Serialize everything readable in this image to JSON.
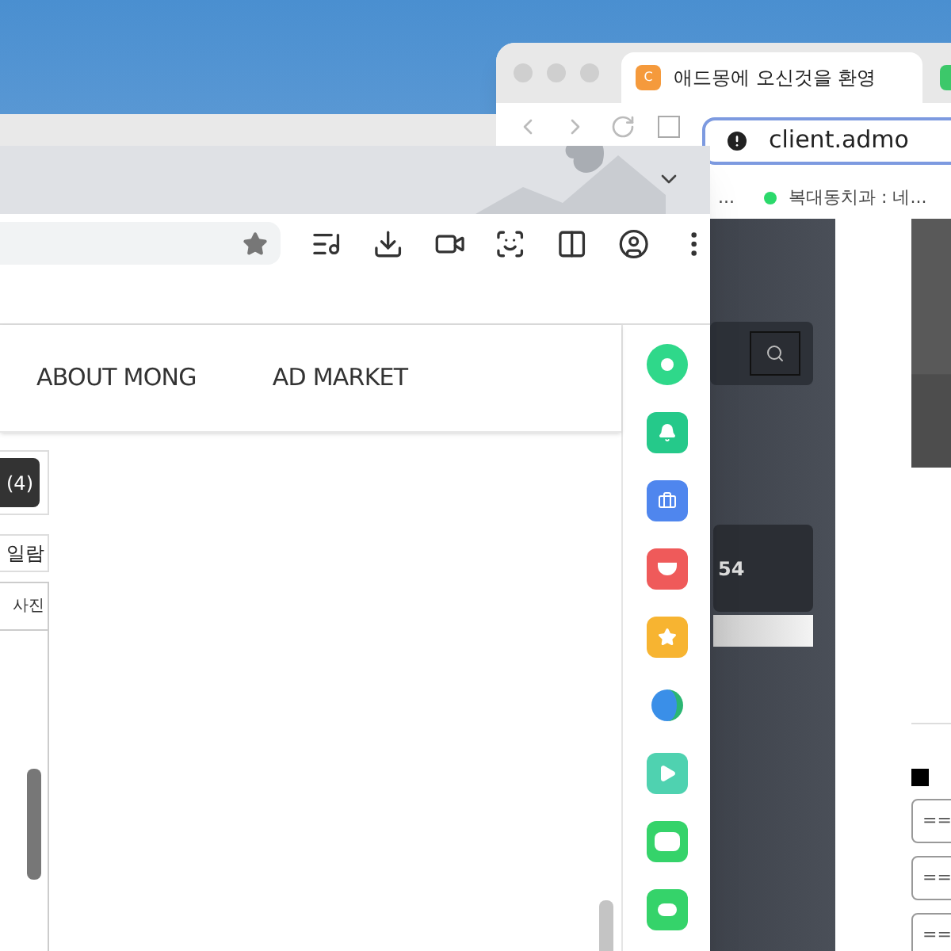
{
  "back_window": {
    "tabs": [
      {
        "title": "애드몽에 오신것을 환영",
        "favicon": "C",
        "color": "#f59a3c",
        "selected": true
      },
      {
        "color": "#3cc86a",
        "selected": false
      }
    ],
    "address": "client.admo",
    "bookmarks": [
      {
        "label": "...",
        "kind": "text"
      },
      {
        "label": "복대동치과 : 네...",
        "kind": "dot",
        "color": "#2bd96b"
      }
    ],
    "stat": "54",
    "fields": [
      {
        "value": "=="
      },
      {
        "value": "=="
      },
      {
        "value": "=="
      }
    ]
  },
  "front_window": {
    "nav": [
      "ABOUT MONG",
      "AD MARKET"
    ],
    "count_button": "(4)",
    "label": "일람",
    "column_header": "사진"
  }
}
